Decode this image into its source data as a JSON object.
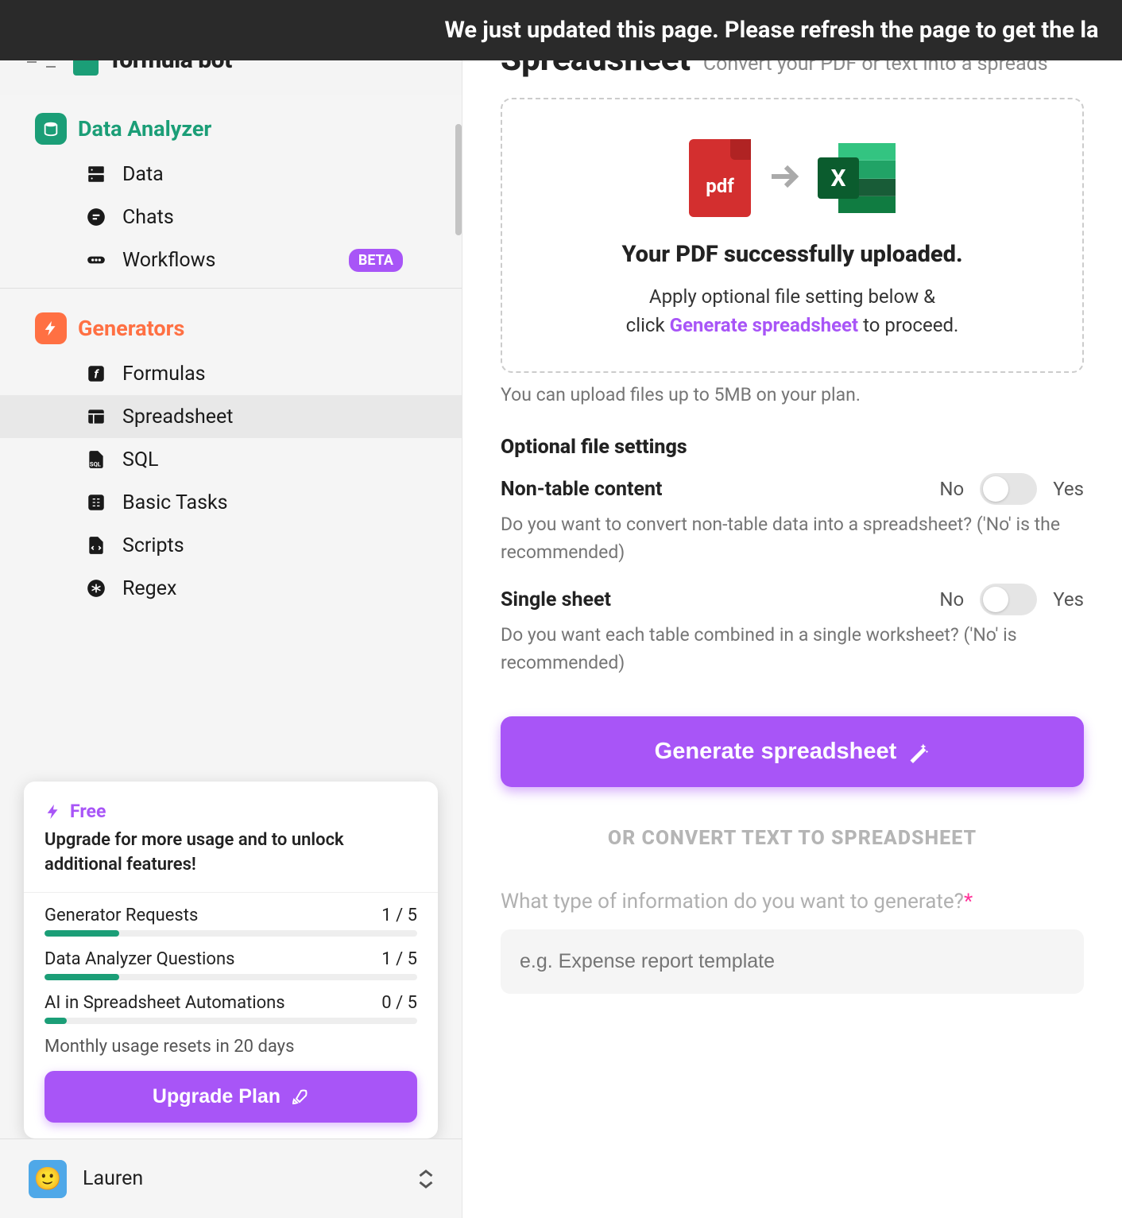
{
  "banner": "We just updated this page. Please refresh the page to get the la",
  "brand": "formula bot",
  "sections": {
    "analyzer": {
      "title": "Data Analyzer"
    },
    "generators": {
      "title": "Generators"
    }
  },
  "nav": {
    "data": "Data",
    "chats": "Chats",
    "workflows": "Workflows",
    "beta": "BETA",
    "formulas": "Formulas",
    "spreadsheet": "Spreadsheet",
    "sql": "SQL",
    "basic_tasks": "Basic Tasks",
    "scripts": "Scripts",
    "regex": "Regex"
  },
  "plan": {
    "tier": "Free",
    "pitch": "Upgrade for more usage and to unlock additional features!",
    "usage": [
      {
        "label": "Generator Requests",
        "value": "1 / 5",
        "pct": 20
      },
      {
        "label": "Data Analyzer Questions",
        "value": "1 / 5",
        "pct": 20
      },
      {
        "label": "AI in Spreadsheet Automations",
        "value": "0 / 5",
        "pct": 6
      }
    ],
    "reset": "Monthly usage resets in 20 days",
    "upgrade_btn": "Upgrade Plan"
  },
  "user": {
    "name": "Lauren"
  },
  "page": {
    "title": "Spreadsheet",
    "subtitle": "Convert your PDF or text into a spreads",
    "upload_success": "Your PDF successfully uploaded.",
    "upload_inst_1": "Apply optional file setting below &",
    "upload_inst_2a": "click ",
    "upload_inst_2b": "Generate spreadsheet",
    "upload_inst_2c": " to proceed.",
    "upload_note": "You can upload files up to 5MB on your plan.",
    "settings_title": "Optional file settings",
    "setting1": {
      "label": "Non-table content",
      "no": "No",
      "yes": "Yes",
      "desc": "Do you want to convert non-table data into a spreadsheet? ('No' is the recommended)"
    },
    "setting2": {
      "label": "Single sheet",
      "no": "No",
      "yes": "Yes",
      "desc": "Do you want each table combined in a single worksheet? ('No' is recommended)"
    },
    "generate_btn": "Generate spreadsheet",
    "or_divider": "OR CONVERT TEXT TO SPREADSHEET",
    "question": "What type of information do you want to generate?",
    "placeholder": "e.g. Expense report template"
  },
  "icons": {
    "pdf": "pdf"
  }
}
